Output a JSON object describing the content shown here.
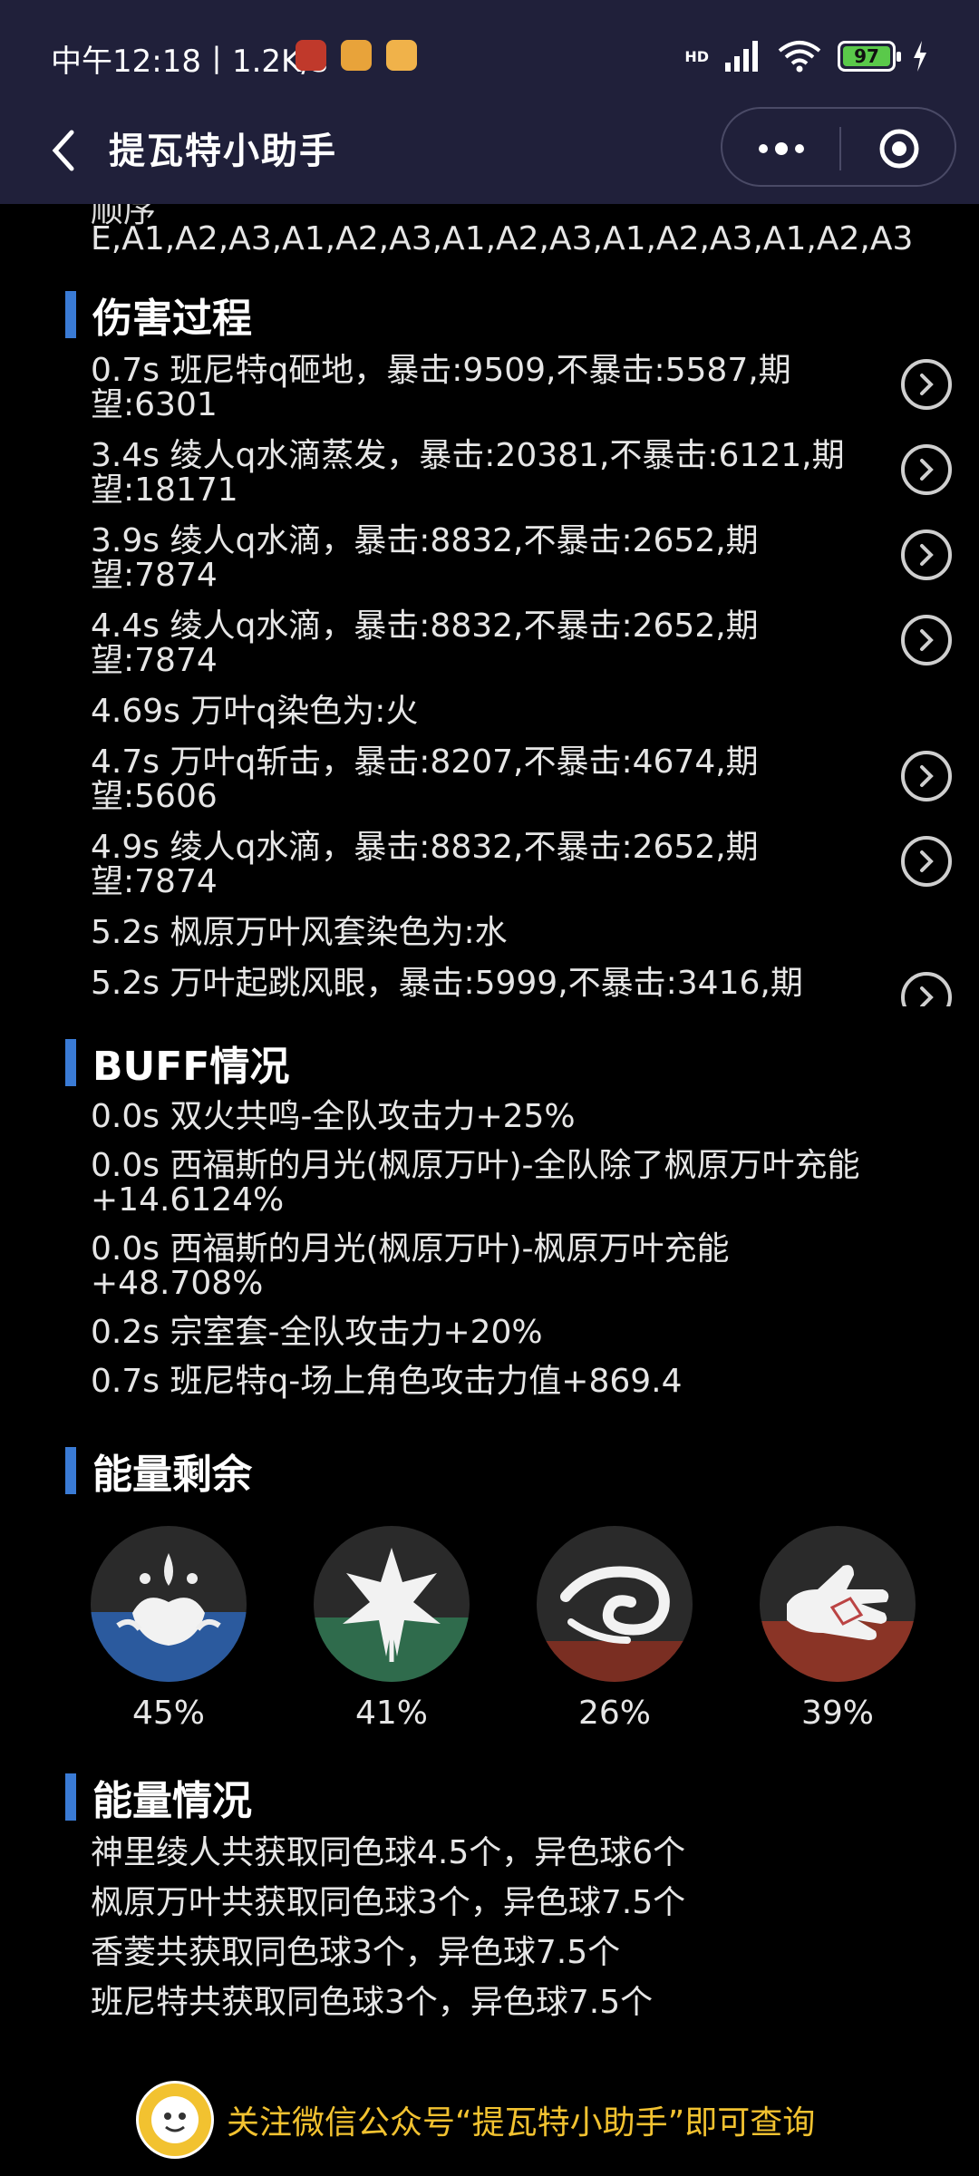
{
  "status": {
    "time": "中午12:18丨1.2K/s",
    "battery": "97",
    "network": "HD"
  },
  "nav": {
    "title": "提瓦特小助手"
  },
  "sequence": {
    "label": "顺序",
    "value": "E,A1,A2,A3,A1,A2,A3,A1,A2,A3,A1,A2,A3,A1,A2,A3"
  },
  "damage": {
    "title": "伤害过程",
    "items": [
      {
        "text": "0.7s 班尼特q砸地，暴击:9509,不暴击:5587,期望:6301",
        "has_detail": true
      },
      {
        "text": "3.4s 绫人q水滴蒸发，暴击:20381,不暴击:6121,期望:18171",
        "has_detail": true
      },
      {
        "text": "3.9s 绫人q水滴，暴击:8832,不暴击:2652,期望:7874",
        "has_detail": true
      },
      {
        "text": "4.4s 绫人q水滴，暴击:8832,不暴击:2652,期望:7874",
        "has_detail": true
      },
      {
        "text": "4.69s 万叶q染色为:火",
        "has_detail": false
      },
      {
        "text": "4.7s 万叶q斩击，暴击:8207,不暴击:4674,期望:5606",
        "has_detail": true
      },
      {
        "text": "4.9s 绫人q水滴，暴击:8832,不暴击:2652,期望:7874",
        "has_detail": true
      },
      {
        "text": "5.2s 枫原万叶风套染色为:水",
        "has_detail": false
      },
      {
        "text": "5.2s 万叶起跳风眼，暴击:5999,不暴击:3416,期",
        "has_detail": true
      }
    ]
  },
  "buff": {
    "title": "BUFF情况",
    "items": [
      "0.0s 双火共鸣-全队攻击力+25%",
      "0.0s 西福斯的月光(枫原万叶)-全队除了枫原万叶充能+14.6124%",
      "0.0s 西福斯的月光(枫原万叶)-枫原万叶充能+48.708%",
      "0.2s 宗室套-全队攻击力+20%",
      "0.7s 班尼特q-场上角色攻击力值+869.4"
    ]
  },
  "energy_left": {
    "title": "能量剩余",
    "items": [
      {
        "icon": "hydro-element-icon",
        "label": "45%",
        "fraction": 0.45,
        "color": "#2b5a9e"
      },
      {
        "icon": "anemo-element-icon",
        "label": "41%",
        "fraction": 0.41,
        "color": "#2f6b4c"
      },
      {
        "icon": "anemo-swirl-icon",
        "label": "26%",
        "fraction": 0.26,
        "color": "#7a2e22"
      },
      {
        "icon": "pyro-hand-icon",
        "label": "39%",
        "fraction": 0.39,
        "color": "#8a3426"
      }
    ]
  },
  "energy_info": {
    "title": "能量情况",
    "items": [
      "神里绫人共获取同色球4.5个，异色球6个",
      "枫原万叶共获取同色球3个，异色球7.5个",
      "香菱共获取同色球3个，异色球7.5个",
      "班尼特共获取同色球3个，异色球7.5个"
    ]
  },
  "footer": {
    "text": "关注微信公众号“提瓦特小助手”即可查询",
    "logo_text": "提瓦特小助手"
  }
}
